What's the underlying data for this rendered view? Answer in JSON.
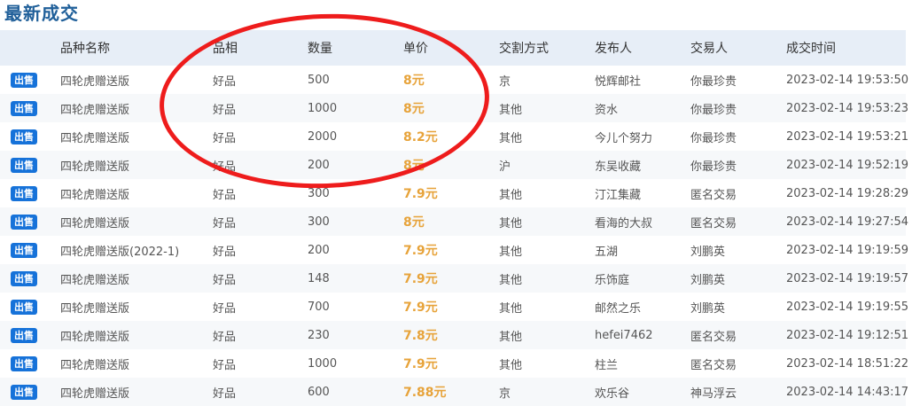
{
  "title": "最新成交",
  "headers": [
    "",
    "品种名称",
    "品相",
    "数量",
    "单价",
    "交割方式",
    "发布人",
    "交易人",
    "成交时间"
  ],
  "rows": [
    {
      "type": "出售",
      "name": "四轮虎赠送版",
      "condition": "好品",
      "qty": "500",
      "price": "8元",
      "delivery": "京",
      "publisher": "悦辉邮社",
      "trader": "你最珍贵",
      "time": "2023-02-14 19:53:50"
    },
    {
      "type": "出售",
      "name": "四轮虎赠送版",
      "condition": "好品",
      "qty": "1000",
      "price": "8元",
      "delivery": "其他",
      "publisher": "资水",
      "trader": "你最珍贵",
      "time": "2023-02-14 19:53:23"
    },
    {
      "type": "出售",
      "name": "四轮虎赠送版",
      "condition": "好品",
      "qty": "2000",
      "price": "8.2元",
      "delivery": "其他",
      "publisher": "今儿个努力",
      "trader": "你最珍贵",
      "time": "2023-02-14 19:53:21"
    },
    {
      "type": "出售",
      "name": "四轮虎赠送版",
      "condition": "好品",
      "qty": "200",
      "price": "8元",
      "delivery": "沪",
      "publisher": "东吴收藏",
      "trader": "你最珍贵",
      "time": "2023-02-14 19:52:19"
    },
    {
      "type": "出售",
      "name": "四轮虎赠送版",
      "condition": "好品",
      "qty": "300",
      "price": "7.9元",
      "delivery": "其他",
      "publisher": "汀江集藏",
      "trader": "匿名交易",
      "time": "2023-02-14 19:28:29"
    },
    {
      "type": "出售",
      "name": "四轮虎赠送版",
      "condition": "好品",
      "qty": "300",
      "price": "8元",
      "delivery": "其他",
      "publisher": "看海的大叔",
      "trader": "匿名交易",
      "time": "2023-02-14 19:27:54"
    },
    {
      "type": "出售",
      "name": "四轮虎赠送版(2022-1)",
      "condition": "好品",
      "qty": "200",
      "price": "7.9元",
      "delivery": "其他",
      "publisher": "五湖",
      "trader": "刘鹏英",
      "time": "2023-02-14 19:19:59"
    },
    {
      "type": "出售",
      "name": "四轮虎赠送版",
      "condition": "好品",
      "qty": "148",
      "price": "7.9元",
      "delivery": "其他",
      "publisher": "乐饰庭",
      "trader": "刘鹏英",
      "time": "2023-02-14 19:19:57"
    },
    {
      "type": "出售",
      "name": "四轮虎赠送版",
      "condition": "好品",
      "qty": "700",
      "price": "7.9元",
      "delivery": "其他",
      "publisher": "邮然之乐",
      "trader": "刘鹏英",
      "time": "2023-02-14 19:19:55"
    },
    {
      "type": "出售",
      "name": "四轮虎赠送版",
      "condition": "好品",
      "qty": "230",
      "price": "7.8元",
      "delivery": "其他",
      "publisher": "hefei7462",
      "trader": "匿名交易",
      "time": "2023-02-14 19:12:51"
    },
    {
      "type": "出售",
      "name": "四轮虎赠送版",
      "condition": "好品",
      "qty": "1000",
      "price": "7.9元",
      "delivery": "其他",
      "publisher": "柱兰",
      "trader": "匿名交易",
      "time": "2023-02-14 18:51:22"
    },
    {
      "type": "出售",
      "name": "四轮虎赠送版",
      "condition": "好品",
      "qty": "600",
      "price": "7.88元",
      "delivery": "京",
      "publisher": "欢乐谷",
      "trader": "神马浮云",
      "time": "2023-02-14 14:43:17"
    }
  ],
  "colors": {
    "title": "#1f5f99",
    "header_bg": "#e7eef7",
    "badge": "#1672d9",
    "price": "#e7a33a",
    "annotation": "#ee1c1c"
  }
}
